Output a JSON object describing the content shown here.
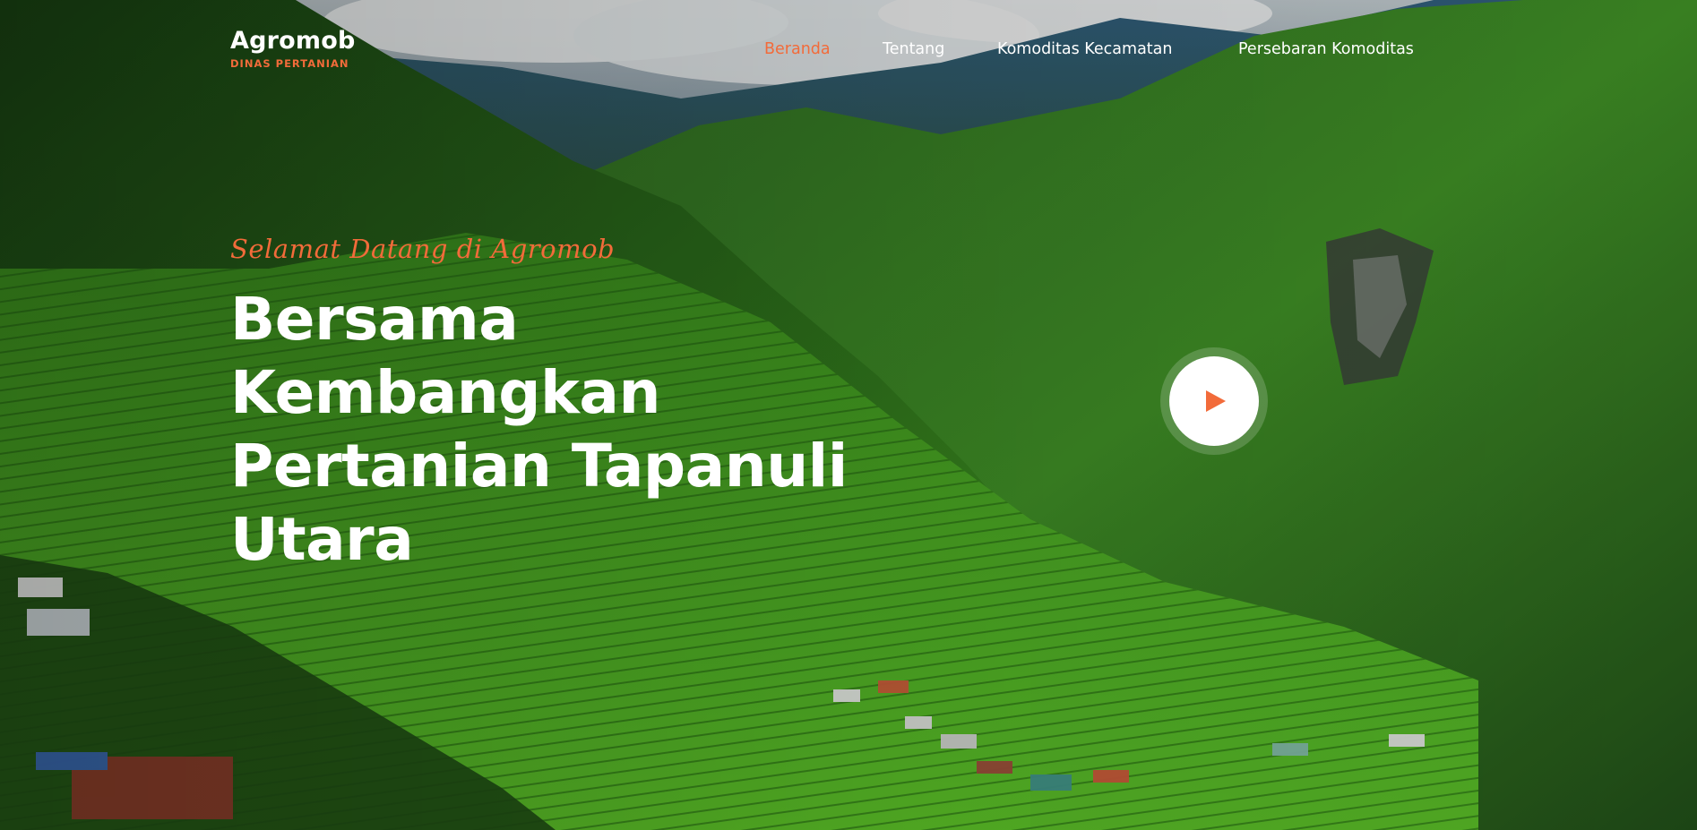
{
  "brand": {
    "name": "Agromob",
    "subtitle": "DINAS PERTANIAN"
  },
  "nav": {
    "items": [
      {
        "label": "Beranda",
        "active": true
      },
      {
        "label": "Tentang",
        "active": false
      },
      {
        "label": "Komoditas Kecamatan",
        "active": false
      },
      {
        "label": "Persebaran Komoditas",
        "active": false
      }
    ]
  },
  "hero": {
    "welcome": "Selamat Datang di Agromob",
    "headline_lines": [
      "Bersama",
      "Kembangkan",
      "Pertanian Tapanuli",
      "Utara"
    ],
    "play_icon": "play-icon",
    "background": "rice-terraces-mountain-valley"
  },
  "colors": {
    "accent": "#f26b3a",
    "text": "#ffffff"
  }
}
